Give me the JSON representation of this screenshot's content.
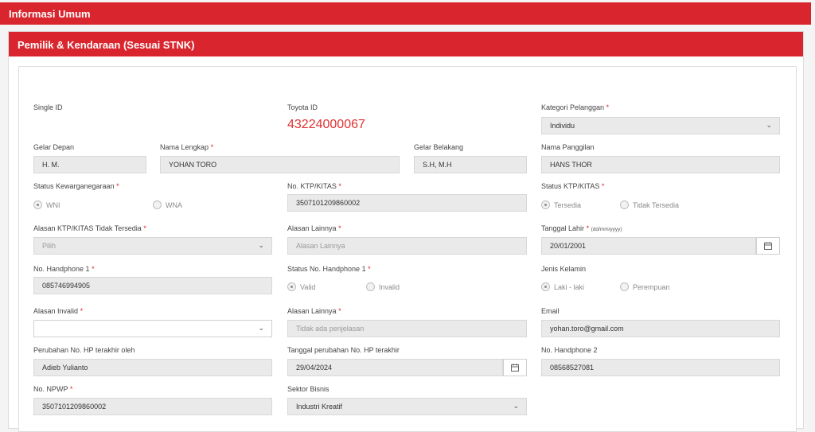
{
  "header": {
    "title": "Informasi Umum"
  },
  "panel": {
    "title": "Pemilik & Kendaraan (Sesuai STNK)"
  },
  "fields": {
    "single_id": {
      "label": "Single ID"
    },
    "toyota_id": {
      "label": "Toyota ID",
      "value": "43224000067"
    },
    "kategori": {
      "label": "Kategori Pelanggan",
      "value": "Individu"
    },
    "gelar_depan": {
      "label": "Gelar Depan",
      "value": "H. M."
    },
    "nama_lengkap": {
      "label": "Nama Lengkap",
      "value": "YOHAN TORO"
    },
    "gelar_belakang": {
      "label": "Gelar Belakang",
      "value": "S.H, M.H"
    },
    "nama_panggilan": {
      "label": "Nama Panggilan",
      "value": "HANS THOR"
    },
    "status_kewarganegaraan": {
      "label": "Status Kewarganegaraan",
      "opt1": "WNI",
      "opt2": "WNA",
      "selected": "WNI"
    },
    "no_ktp": {
      "label": "No. KTP/KITAS",
      "value": "3507101209860002"
    },
    "status_ktp": {
      "label": "Status KTP/KITAS",
      "opt1": "Tersedia",
      "opt2": "Tidak Tersedia",
      "selected": "Tersedia"
    },
    "alasan_ktp": {
      "label": "Alasan KTP/KITAS Tidak Tersedia",
      "value": "Pilih"
    },
    "alasan_lainnya_1": {
      "label": "Alasan Lainnya",
      "placeholder": "Alasan Lainnya"
    },
    "tanggal_lahir": {
      "label": "Tanggal Lahir",
      "hint": "(dd/mm/yyyy)",
      "value": "20/01/2001"
    },
    "no_hp1": {
      "label": "No. Handphone 1",
      "value": "085746994905"
    },
    "status_hp1": {
      "label": "Status No. Handphone 1",
      "opt1": "Valid",
      "opt2": "Invalid",
      "selected": "Valid"
    },
    "jenis_kelamin": {
      "label": "Jenis Kelamin",
      "opt1": "Laki - laki",
      "opt2": "Perempuan",
      "selected": "Laki - laki"
    },
    "alasan_invalid": {
      "label": "Alasan Invalid",
      "value": ""
    },
    "alasan_lainnya_2": {
      "label": "Alasan Lainnya",
      "placeholder": "Tidak ada penjelasan"
    },
    "email": {
      "label": "Email",
      "value": "yohan.toro@gmail.com"
    },
    "perubahan_oleh": {
      "label": "Perubahan No. HP terakhir oleh",
      "value": "Adieb Yulianto"
    },
    "tanggal_perubahan": {
      "label": "Tanggal perubahan No. HP terakhir",
      "value": "29/04/2024"
    },
    "no_hp2": {
      "label": "No. Handphone 2",
      "value": "08568527081"
    },
    "no_npwp": {
      "label": "No. NPWP",
      "value": "3507101209860002"
    },
    "sektor_bisnis": {
      "label": "Sektor Bisnis",
      "value": "Industri Kreatif"
    }
  },
  "required_mark": "*",
  "icons": {
    "dropdown": "chevron-down-icon",
    "calendar": "calendar-icon"
  },
  "colors": {
    "accent": "#d9262e",
    "toyota_id": "#e23131"
  }
}
